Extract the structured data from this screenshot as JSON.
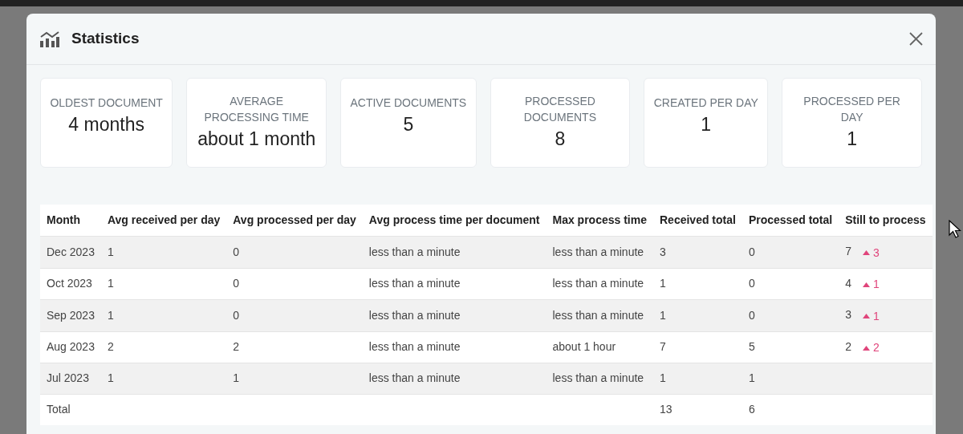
{
  "modal": {
    "title": "Statistics"
  },
  "stats": [
    {
      "label": "OLDEST DOCUMENT",
      "value": "4 months"
    },
    {
      "label": "AVERAGE PROCESSING TIME",
      "value": "about 1 month"
    },
    {
      "label": "ACTIVE DOCUMENTS",
      "value": "5"
    },
    {
      "label": "PROCESSED DOCUMENTS",
      "value": "8"
    },
    {
      "label": "CREATED PER DAY",
      "value": "1"
    },
    {
      "label": "PROCESSED PER DAY",
      "value": "1"
    }
  ],
  "table": {
    "columns": [
      "Month",
      "Avg received per day",
      "Avg processed per day",
      "Avg process time per document",
      "Max process time",
      "Received total",
      "Processed total",
      "Still to process"
    ],
    "rows": [
      {
        "cells": [
          "Dec 2023",
          "1",
          "0",
          "less than a minute",
          "less than a minute",
          "3",
          "0",
          "7"
        ],
        "change": {
          "kind": "up",
          "text": "3"
        }
      },
      {
        "cells": [
          "Oct 2023",
          "1",
          "0",
          "less than a minute",
          "less than a minute",
          "1",
          "0",
          "4"
        ],
        "change": {
          "kind": "up",
          "text": "1"
        }
      },
      {
        "cells": [
          "Sep 2023",
          "1",
          "0",
          "less than a minute",
          "less than a minute",
          "1",
          "0",
          "3"
        ],
        "change": {
          "kind": "up",
          "text": "1"
        }
      },
      {
        "cells": [
          "Aug 2023",
          "2",
          "2",
          "less than a minute",
          "about 1 hour",
          "7",
          "5",
          "2"
        ],
        "change": {
          "kind": "up",
          "text": "2"
        }
      },
      {
        "cells": [
          "Jul 2023",
          "1",
          "1",
          "less than a minute",
          "less than a minute",
          "1",
          "1",
          ""
        ]
      }
    ],
    "total": {
      "cells": [
        "Total",
        "",
        "",
        "",
        "",
        "13",
        "6",
        ""
      ]
    }
  }
}
